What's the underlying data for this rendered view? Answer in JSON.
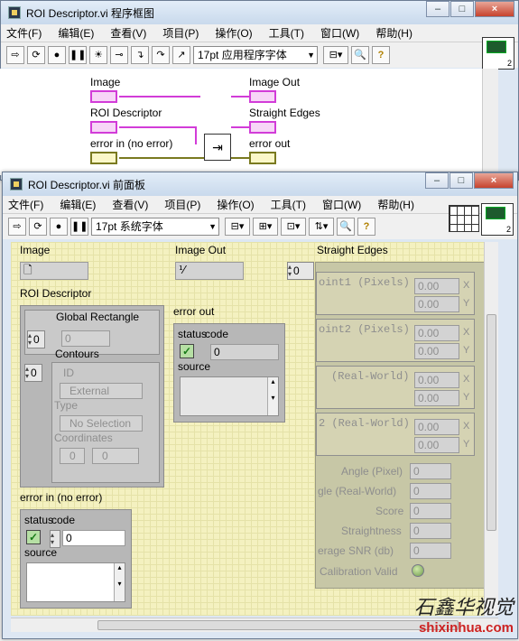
{
  "bd_window": {
    "title": "ROI Descriptor.vi 程序框图",
    "menu": [
      "文件(F)",
      "编辑(E)",
      "查看(V)",
      "项目(P)",
      "操作(O)",
      "工具(T)",
      "窗口(W)",
      "帮助(H)"
    ],
    "font_select": "17pt 应用程序字体",
    "terminals": {
      "image": "Image",
      "roi_descriptor": "ROI Descriptor",
      "error_in": "error in (no error)",
      "image_out": "Image Out",
      "straight_edges": "Straight Edges",
      "error_out": "error out"
    },
    "icon_number": "2"
  },
  "fp_window": {
    "title": "ROI Descriptor.vi 前面板",
    "menu": [
      "文件(F)",
      "编辑(E)",
      "查看(V)",
      "项目(P)",
      "操作(O)",
      "工具(T)",
      "窗口(W)",
      "帮助(H)"
    ],
    "font_select": "17pt 系统字体",
    "icon_number": "2"
  },
  "panel": {
    "image_label": "Image",
    "image_out_label": "Image Out",
    "roi_label": "ROI Descriptor",
    "global_rect_label": "Global Rectangle",
    "global_rect_index": "0",
    "global_rect_value": "0",
    "contours_label": "Contours",
    "contours_index": "0",
    "id_label": "ID",
    "external_value": "External",
    "type_label": "Type",
    "no_selection": "No Selection",
    "coordinates_label": "Coordinates",
    "coord_index": "0",
    "coord_value": "0",
    "error_out_label": "error out",
    "status_label": "status",
    "code_label": "code",
    "source_label": "source",
    "error_out_code": "0",
    "error_in_label": "error in (no error)",
    "error_in_code": "0",
    "straight_edges_label": "Straight Edges",
    "straight_edges_index": "0",
    "point1_label": "oint1 (Pixels)",
    "point2_label": "oint2 (Pixels)",
    "p1_real_label": "(Real-World)",
    "p2_real_label": "2 (Real-World)",
    "x_label": "X",
    "y_label": "Y",
    "coord_zero": "0.00",
    "angle_pixel_label": "Angle (Pixel)",
    "angle_real_label": "gle (Real-World)",
    "score_label": "Score",
    "straightness_label": "Straightness",
    "snr_label": "erage SNR (db)",
    "calib_label": "Calibration Valid",
    "metric_zero": "0"
  },
  "watermark": {
    "line1": "石鑫华视觉",
    "line2": "shixinhua.com"
  }
}
